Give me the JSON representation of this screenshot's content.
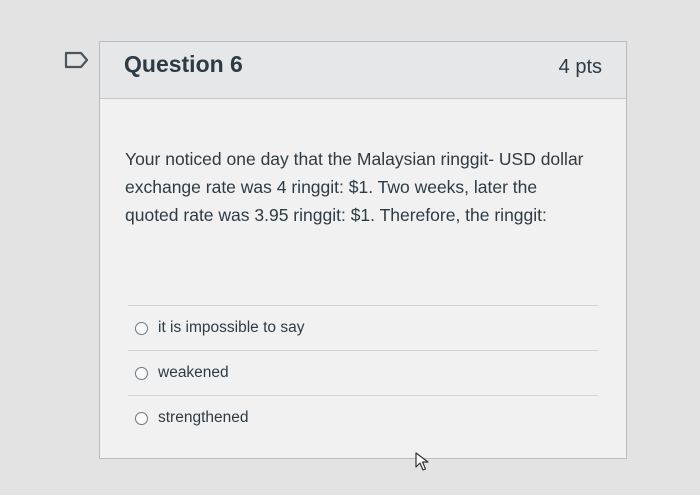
{
  "question": {
    "title": "Question 6",
    "points": "4 pts",
    "text": "Your noticed one day that the Malaysian ringgit- USD dollar exchange rate was 4 ringgit: $1. Two weeks, later the quoted rate was 3.95 ringgit: $1. Therefore, the ringgit:",
    "flag_icon": "flag-question-icon",
    "answers": [
      {
        "label": "it is impossible to say",
        "selected": false
      },
      {
        "label": "weakened",
        "selected": false
      },
      {
        "label": "strengthened",
        "selected": false
      }
    ]
  },
  "colors": {
    "header_bg": "#e6e7e8",
    "text": "#2d3b45",
    "border": "#b9bcbf"
  }
}
